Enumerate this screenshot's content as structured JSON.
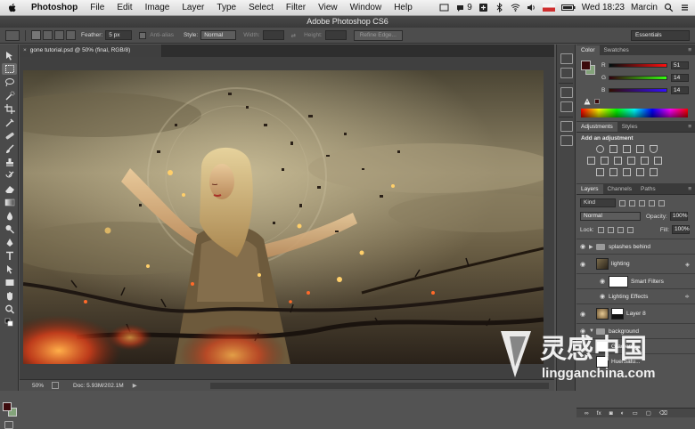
{
  "menubar": {
    "app_name": "Photoshop",
    "items": [
      "File",
      "Edit",
      "Image",
      "Layer",
      "Type",
      "Select",
      "Filter",
      "View",
      "Window",
      "Help"
    ],
    "tray_badge": "9",
    "clock": "Wed 18:23",
    "user": "Marcin"
  },
  "window": {
    "title": "Adobe Photoshop CS6"
  },
  "options": {
    "feather_label": "Feather:",
    "feather_value": "5 px",
    "antialias_label": "Anti-alias",
    "style_label": "Style:",
    "style_value": "Normal",
    "width_label": "Width:",
    "height_label": "Height:",
    "refine_edge_label": "Refine Edge...",
    "workspace_label": "Essentials"
  },
  "document": {
    "tab_title": "gone tutorial.psd @ 50% (final, RGB/8)",
    "tab_close": "×"
  },
  "status": {
    "zoom": "50%",
    "doc_size": "Doc: 5.93M/202.1M",
    "arrow": "▶"
  },
  "color_panel": {
    "tabs": [
      "Color",
      "Swatches"
    ],
    "channels": [
      {
        "label": "R",
        "value": "51"
      },
      {
        "label": "G",
        "value": "14"
      },
      {
        "label": "B",
        "value": "14"
      }
    ],
    "foreground": "#3c0a0c",
    "background": "#83a37a"
  },
  "adjustments_panel": {
    "tabs": [
      "Adjustments",
      "Styles"
    ],
    "title": "Add an adjustment"
  },
  "layers_panel": {
    "tabs": [
      "Layers",
      "Channels",
      "Paths"
    ],
    "kind_label": "Kind",
    "blend_mode": "Normal",
    "opacity_label": "Opacity:",
    "opacity_value": "100%",
    "lock_label": "Lock:",
    "fill_label": "Fill:",
    "fill_value": "100%",
    "layers": [
      {
        "name": "splashes behind",
        "type": "group"
      },
      {
        "name": "lighting",
        "type": "smart"
      },
      {
        "name": "Smart Filters",
        "type": "filter"
      },
      {
        "name": "Lighting Effects",
        "type": "filter-item"
      },
      {
        "name": "Layer 8",
        "type": "layer"
      },
      {
        "name": "background",
        "type": "group"
      },
      {
        "name": "Gradient",
        "type": "adjustment"
      },
      {
        "name": "Hue/Satu...",
        "type": "adjustment"
      }
    ],
    "footer_icons": [
      "link-icon",
      "fx-icon",
      "mask-icon",
      "adjustment-icon",
      "folder-icon",
      "new-layer-icon",
      "trash-icon"
    ]
  },
  "watermark": {
    "cn": "灵感中国",
    "url": "lingganchina.com"
  }
}
